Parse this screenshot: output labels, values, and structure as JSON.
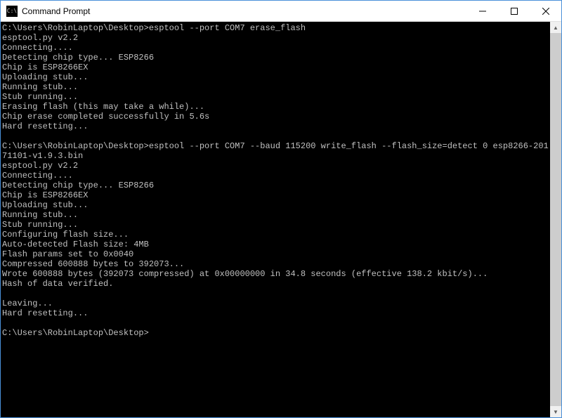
{
  "window": {
    "title": "Command Prompt",
    "icon_text": "C:\\"
  },
  "terminal": {
    "lines": [
      {
        "prompt": "C:\\Users\\RobinLaptop\\Desktop>",
        "cmd": "esptool --port COM7 erase_flash"
      },
      {
        "out": "esptool.py v2.2"
      },
      {
        "out": "Connecting...."
      },
      {
        "out": "Detecting chip type... ESP8266"
      },
      {
        "out": "Chip is ESP8266EX"
      },
      {
        "out": "Uploading stub..."
      },
      {
        "out": "Running stub..."
      },
      {
        "out": "Stub running..."
      },
      {
        "out": "Erasing flash (this may take a while)..."
      },
      {
        "out": "Chip erase completed successfully in 5.6s"
      },
      {
        "out": "Hard resetting..."
      },
      {
        "out": ""
      },
      {
        "prompt": "C:\\Users\\RobinLaptop\\Desktop>",
        "cmd": "esptool --port COM7 --baud 115200 write_flash --flash_size=detect 0 esp8266-20171101-v1.9.3.bin"
      },
      {
        "out": "esptool.py v2.2"
      },
      {
        "out": "Connecting...."
      },
      {
        "out": "Detecting chip type... ESP8266"
      },
      {
        "out": "Chip is ESP8266EX"
      },
      {
        "out": "Uploading stub..."
      },
      {
        "out": "Running stub..."
      },
      {
        "out": "Stub running..."
      },
      {
        "out": "Configuring flash size..."
      },
      {
        "out": "Auto-detected Flash size: 4MB"
      },
      {
        "out": "Flash params set to 0x0040"
      },
      {
        "out": "Compressed 600888 bytes to 392073..."
      },
      {
        "out": "Wrote 600888 bytes (392073 compressed) at 0x00000000 in 34.8 seconds (effective 138.2 kbit/s)..."
      },
      {
        "out": "Hash of data verified."
      },
      {
        "out": ""
      },
      {
        "out": "Leaving..."
      },
      {
        "out": "Hard resetting..."
      },
      {
        "out": ""
      },
      {
        "prompt": "C:\\Users\\RobinLaptop\\Desktop>",
        "cmd": ""
      }
    ]
  }
}
